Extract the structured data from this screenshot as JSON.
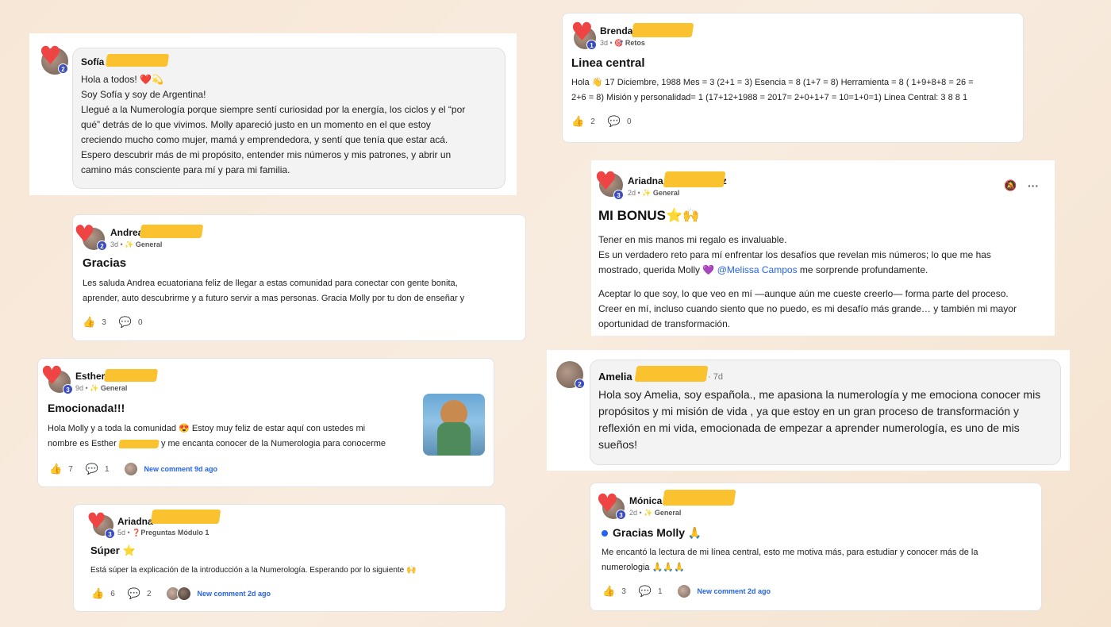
{
  "posts": {
    "sofia": {
      "name": "Sofía",
      "lines": [
        "Hola a todos! ❤️💫",
        "Soy Sofía y soy de Argentina!",
        "Llegué a la Numerología porque siempre sentí curiosidad por la energía, los ciclos y el “por",
        "qué” detrás de lo que vivimos. Molly apareció justo en un momento en el que estoy",
        "creciendo mucho como mujer, mamá y emprendedora, y sentí que tenía que estar acá.",
        "Espero descubrir más de mi propósito, entender mis números y mis patrones, y abrir un",
        "camino más consciente para mí y para mi familia."
      ],
      "level": "2"
    },
    "andrea": {
      "name": "Andrea",
      "meta_time": "3d",
      "category": "✨ General",
      "title": "Gracias",
      "lines": [
        "Les saluda Andrea ecuatoriana feliz de llegar a estas comunidad para conectar con gente bonita,",
        "aprender, auto descubrirme y a futuro servir a mas personas. Gracia Molly por tu don de enseñar y"
      ],
      "likes": "3",
      "comments": "0",
      "level": "2"
    },
    "esther": {
      "name": "Esther",
      "meta_time": "9d",
      "category": "✨ General",
      "title": "Emocionada!!!",
      "lines": [
        "Hola Molly y a toda la comunidad 😍 Estoy muy feliz de estar aquí con ustedes mi",
        "nombre es Esther",
        "y me encanta conocer de la Numerologia para conocerme"
      ],
      "likes": "7",
      "comments": "1",
      "new_comment": "New comment 9d ago",
      "level": "3"
    },
    "ariadna_small": {
      "name": "Ariadna",
      "meta_time": "5d",
      "category": "❓Preguntas Módulo 1",
      "title": "Súper ⭐",
      "lines": [
        "Está súper la explicación de la introducción a la Numerología. Esperando por lo siguiente 🙌"
      ],
      "likes": "6",
      "comments": "2",
      "new_comment": "New comment 2d ago",
      "level": "3"
    },
    "brenda": {
      "name": "Brenda",
      "meta_time": "3d",
      "category": "🎯 Retos",
      "title": "Linea central",
      "lines": [
        "Hola 👋 17 Diciembre, 1988 Mes = 3 (2+1 = 3) Esencia = 8 (1+7 = 8) Herramienta = 8 ( 1+9+8+8 = 26 =",
        "2+6 = 8) Misión y personalidad= 1 (17+12+1988 = 2017= 2+0+1+7 = 10=1+0=1) Linea Central: 3 8 8 1"
      ],
      "likes": "2",
      "comments": "0",
      "level": "1"
    },
    "ariadna_big": {
      "name": "Ariadna",
      "name_suffix": "z",
      "meta_time": "2d",
      "category": "✨ General",
      "title": "MI BONUS⭐🙌",
      "lines": [
        "Tener en mis manos mi regalo es invaluable.",
        "Es un verdadero reto para mí enfrentar los desafíos que revelan mis números; lo que me has",
        "mostrado, querida Molly 💜",
        "@Melissa Campos",
        "me sorprende profundamente.",
        "Aceptar lo que soy, lo que veo en mí —aunque aún me cueste creerlo— forma parte del proceso.",
        "Creer en mí, incluso cuando siento que no puedo, es mi desafío más grande… y también mi mayor",
        "oportunidad de transformación."
      ],
      "level": "3"
    },
    "amelia": {
      "name": "Amelia",
      "meta_time": "· 7d",
      "lines": [
        "Hola soy Amelia, soy española., me apasiona la numerología y me emociona conocer mis",
        "propósitos y mi misión de vida , ya que estoy en un gran proceso de transformación y",
        "reflexión en mi vida, emocionada de empezar a aprender numerología, es uno de mis",
        "sueños!"
      ],
      "level": "2"
    },
    "monica": {
      "name": "Mónica",
      "meta_time": "2d",
      "category": "✨ General",
      "title": "Gracias Molly 🙏",
      "lines": [
        "Me encantó la lectura de mi línea central, esto me motiva más, para estudiar y conocer más de la",
        "numerologia 🙏🙏🙏"
      ],
      "likes": "3",
      "comments": "1",
      "new_comment": "New comment 2d ago",
      "level": "3"
    }
  },
  "icons": {
    "like": "thumbs-up-icon",
    "comment": "comment-icon",
    "bell": "bell-off-icon",
    "more": "more-icon"
  },
  "colors": {
    "redaction": "#f9c22e",
    "link": "#2563eb",
    "level_badge": "#3b4cc0"
  }
}
